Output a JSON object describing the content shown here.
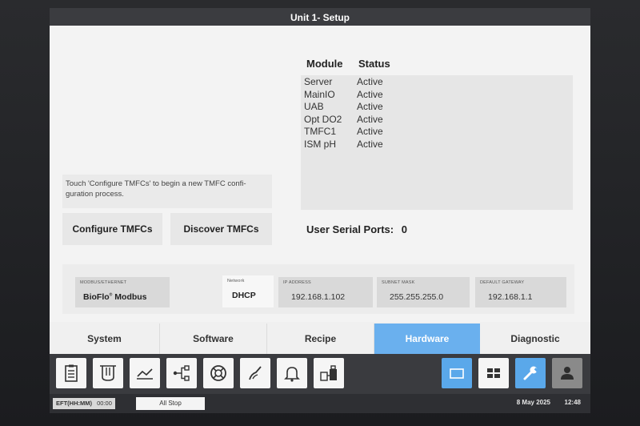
{
  "window": {
    "title": "Unit 1- Setup"
  },
  "modules": {
    "header_module": "Module",
    "header_status": "Status",
    "rows": [
      {
        "module": "Server",
        "status": "Active"
      },
      {
        "module": "MainIO",
        "status": "Active"
      },
      {
        "module": "UAB",
        "status": "Active"
      },
      {
        "module": "Opt DO2",
        "status": "Active"
      },
      {
        "module": "TMFC1",
        "status": "Active"
      },
      {
        "module": "ISM pH",
        "status": "Active"
      }
    ]
  },
  "tmfc": {
    "instructions": "Touch 'Configure TMFCs' to begin a new TMFC confi-guration process.",
    "configure_label": "Configure TMFCs",
    "discover_label": "Discover TMFCs"
  },
  "serial_ports": {
    "label": "User Serial Ports:",
    "count": "0"
  },
  "network": {
    "protocol_label": "MODBUS/ETHERNET",
    "protocol_brand": "BioFlo",
    "protocol_mark": "®",
    "protocol_value": "Modbus",
    "mode_label": "Network",
    "mode_value": "DHCP",
    "ip_label": "IP ADDRESS",
    "ip_value": "192.168.1.102",
    "subnet_label": "SUBNET MASK",
    "subnet_value": "255.255.255.0",
    "gateway_label": "DEFAULT GATEWAY",
    "gateway_value": "192.168.1.1"
  },
  "tabs": [
    {
      "label": "System",
      "active": false
    },
    {
      "label": "Software",
      "active": false
    },
    {
      "label": "Recipe",
      "active": false
    },
    {
      "label": "Hardware",
      "active": true
    },
    {
      "label": "Diagnostic",
      "active": false
    }
  ],
  "toolbar": {
    "icons": [
      "clipboard-icon",
      "vessel-icon",
      "trend-chart-icon",
      "network-nodes-icon",
      "lifebuoy-icon",
      "sensor-probe-icon",
      "alarm-bell-icon",
      "gas-mix-icon",
      "single-view-icon",
      "grid-view-icon",
      "wrench-icon",
      "user-icon"
    ]
  },
  "status": {
    "eft_label": "EFT(HH:MM)",
    "eft_value": "00:00",
    "all_stop": "All Stop",
    "date": "8 May 2025",
    "time": "12:48"
  },
  "colors": {
    "accent_tab": "#6ab0ee",
    "toolbar_bg": "#3a3b3f",
    "active_tool": "#5aa8ea"
  }
}
